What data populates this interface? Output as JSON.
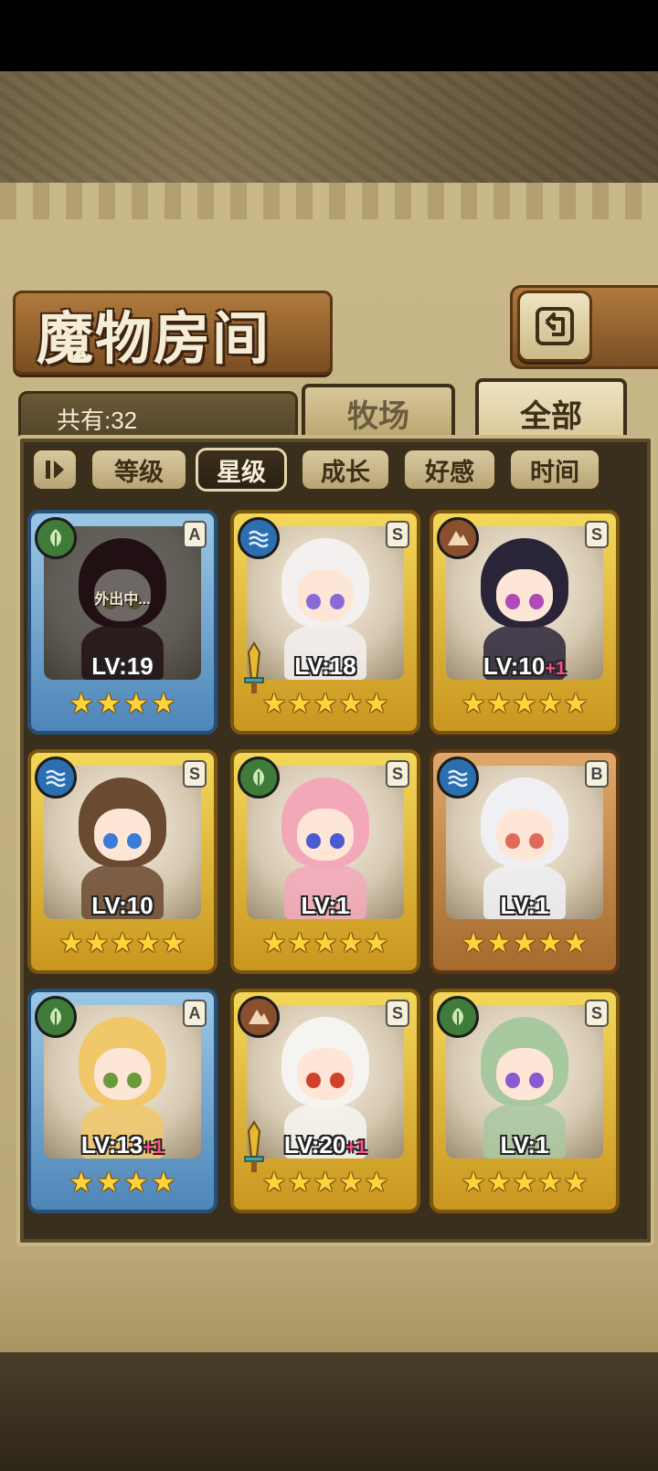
{
  "screen": {
    "title": "魔物房间",
    "count_label": "共有:32"
  },
  "tabs": [
    {
      "label": "牧场"
    },
    {
      "label": "全部"
    }
  ],
  "sort": {
    "buttons": [
      {
        "label": "等级",
        "active": false
      },
      {
        "label": "星级",
        "active": true
      },
      {
        "label": "成长",
        "active": false
      },
      {
        "label": "好感",
        "active": false
      },
      {
        "label": "时间",
        "active": false
      }
    ]
  },
  "cards": [
    {
      "element": "leaf",
      "rank": "A",
      "level": "LV:19",
      "plus": "",
      "stars": 4,
      "frame": "blue",
      "status": "外出中...",
      "weapon": false,
      "hair": "#5a1f2a",
      "eye": "#c9a23a"
    },
    {
      "element": "water",
      "rank": "S",
      "level": "LV:18",
      "plus": "",
      "stars": 5,
      "frame": "gold",
      "status": "",
      "weapon": true,
      "hair": "#f4f0f0",
      "eye": "#8a6ad8"
    },
    {
      "element": "earth",
      "rank": "S",
      "level": "LV:10",
      "plus": "+1",
      "stars": 5,
      "frame": "gold",
      "status": "",
      "weapon": false,
      "hair": "#2a2438",
      "eye": "#b04ab8"
    },
    {
      "element": "water",
      "rank": "S",
      "level": "LV:10",
      "plus": "",
      "stars": 5,
      "frame": "gold",
      "status": "",
      "weapon": false,
      "hair": "#6a4a30",
      "eye": "#3a7ad8"
    },
    {
      "element": "leaf",
      "rank": "S",
      "level": "LV:1",
      "plus": "",
      "stars": 5,
      "frame": "gold",
      "status": "",
      "weapon": false,
      "hair": "#f2a8b8",
      "eye": "#4a5ad0"
    },
    {
      "element": "water",
      "rank": "B",
      "level": "LV:1",
      "plus": "",
      "stars": 5,
      "frame": "bronze",
      "status": "",
      "weapon": false,
      "hair": "#f0f0f4",
      "eye": "#e06a5a"
    },
    {
      "element": "leaf",
      "rank": "A",
      "level": "LV:13",
      "plus": "+1",
      "stars": 4,
      "frame": "blue",
      "status": "",
      "weapon": false,
      "hair": "#f0c86a",
      "eye": "#6a9a3a"
    },
    {
      "element": "earth",
      "rank": "S",
      "level": "LV:20",
      "plus": "+1",
      "stars": 5,
      "frame": "gold",
      "status": "",
      "weapon": true,
      "hair": "#f6f4f0",
      "eye": "#d0402a"
    },
    {
      "element": "leaf",
      "rank": "S",
      "level": "LV:1",
      "plus": "",
      "stars": 5,
      "frame": "gold",
      "status": "",
      "weapon": false,
      "hair": "#a8c8a0",
      "eye": "#8a5ad0"
    }
  ],
  "colors": {
    "accent_plus": "#ff4c8a",
    "star": "#ffd43a"
  }
}
